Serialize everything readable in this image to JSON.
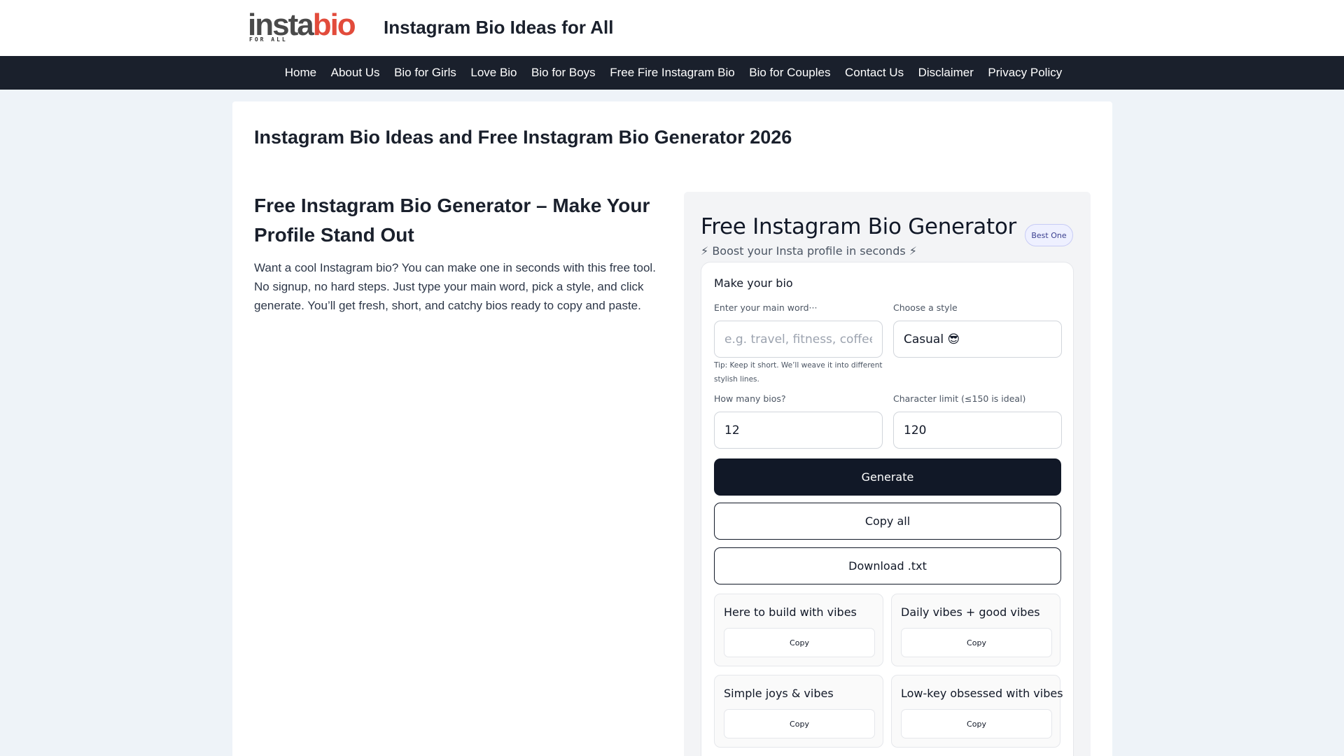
{
  "header": {
    "logo": {
      "part_a": "insta",
      "part_b": "bio",
      "tagline": "FOR ALL"
    },
    "site_title": "Instagram Bio Ideas for All"
  },
  "nav": {
    "items": [
      "Home",
      "About Us",
      "Bio for Girls",
      "Love Bio",
      "Bio for Boys",
      "Free Fire Instagram Bio",
      "Bio for Couples",
      "Contact Us",
      "Disclaimer",
      "Privacy Policy"
    ]
  },
  "main": {
    "page_title": "Instagram Bio Ideas and Free Instagram Bio Generator 2026",
    "section_heading": "Free Instagram Bio Generator – Make Your Profile Stand Out",
    "intro": "Want a cool Instagram bio? You can make one in seconds with this free tool. No signup, no hard steps. Just type your main word, pick a style, and click generate. You’ll get fresh, short, and catchy bios ready to copy and paste."
  },
  "generator": {
    "title": "Free Instagram Bio Generator",
    "badge": "Best One",
    "subtitle": "⚡ Boost your Insta profile in seconds ⚡",
    "form": {
      "heading": "Make your bio",
      "keyword_label": "Enter your main word···",
      "keyword_placeholder": "e.g. travel, fitness, coffee, a",
      "keyword_value": "",
      "style_label": "Choose a style",
      "style_value": "Casual 😎",
      "tip": "Tip: Keep it short. We’ll weave it into different stylish lines.",
      "count_label": "How many bios?",
      "count_value": "12",
      "limit_label": "Character limit (≤150 is ideal)",
      "limit_value": "120",
      "generate_label": "Generate",
      "copy_all_label": "Copy all",
      "download_label": "Download .txt"
    },
    "results": [
      {
        "text": "Here to build with vibes",
        "copy": "Copy"
      },
      {
        "text": "Daily vibes + good vibes",
        "copy": "Copy"
      },
      {
        "text": "Simple joys & vibes",
        "copy": "Copy"
      },
      {
        "text": "Low-key obsessed with vibes",
        "copy": "Copy"
      }
    ]
  },
  "colors": {
    "nav_bg": "#1a202c",
    "page_bg": "#eef3f8",
    "logo_accent": "#e24b3b",
    "primary_button": "#111827"
  }
}
